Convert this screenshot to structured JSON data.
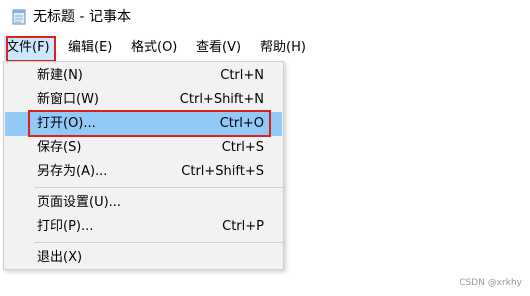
{
  "window": {
    "title": "无标题 - 记事本",
    "icon": "notepad-icon"
  },
  "menubar": {
    "items": [
      {
        "label": "文件(F)",
        "active": true
      },
      {
        "label": "编辑(E)"
      },
      {
        "label": "格式(O)"
      },
      {
        "label": "查看(V)"
      },
      {
        "label": "帮助(H)"
      }
    ]
  },
  "file_menu": {
    "items": [
      {
        "label": "新建(N)",
        "shortcut": "Ctrl+N"
      },
      {
        "label": "新窗口(W)",
        "shortcut": "Ctrl+Shift+N"
      },
      {
        "label": "打开(O)...",
        "shortcut": "Ctrl+O",
        "selected": true
      },
      {
        "label": "保存(S)",
        "shortcut": "Ctrl+S"
      },
      {
        "label": "另存为(A)...",
        "shortcut": "Ctrl+Shift+S"
      },
      {
        "label": "页面设置(U)...",
        "shortcut": ""
      },
      {
        "label": "打印(P)...",
        "shortcut": "Ctrl+P"
      },
      {
        "label": "退出(X)",
        "shortcut": ""
      }
    ]
  },
  "colors": {
    "highlight_border": "#e0201c",
    "menu_active_bg": "#cce8ff",
    "item_selected_bg": "#91c9f7"
  },
  "watermark": "CSDN @xrkhy"
}
